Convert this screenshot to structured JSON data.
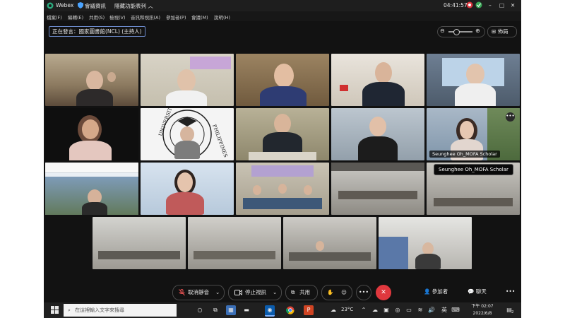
{
  "window": {
    "app_name": "Webex",
    "meeting_info": "會議資訊",
    "hide_menu": "隱藏功能表列",
    "time": "04:41:57"
  },
  "menu": {
    "items": [
      "檔案(F)",
      "編輯(E)",
      "共用(S)",
      "檢視(V)",
      "音訊和視訊(A)",
      "參加者(P)",
      "會議(M)",
      "說明(H)"
    ]
  },
  "speaker": {
    "label": "正在發言：國家圖書館(NCL) (主持人)"
  },
  "layout_button": {
    "label": "佈局"
  },
  "participants": {
    "seunghee_name": "Seunghee Oh_MOFA Scholar",
    "seunghee_tooltip": "Seunghee Oh_MOFA Scholar",
    "more_label": "•••"
  },
  "controls": {
    "unmute": "取消靜音",
    "stop_video": "停止視訊",
    "share": "共用",
    "participants": "參加者",
    "chat": "聊天",
    "more": "•••",
    "overflow": "•••"
  },
  "taskbar": {
    "search_placeholder": "在這裡輸入文字來搜尋",
    "temperature": "23°C",
    "ime": "英",
    "clock_time": "下午 02:07",
    "clock_date": "2022/6/8",
    "notification_count": "2"
  },
  "colors": {
    "accent_blue": "#6b89c9",
    "end_red": "#e0383e",
    "background": "#121212"
  }
}
